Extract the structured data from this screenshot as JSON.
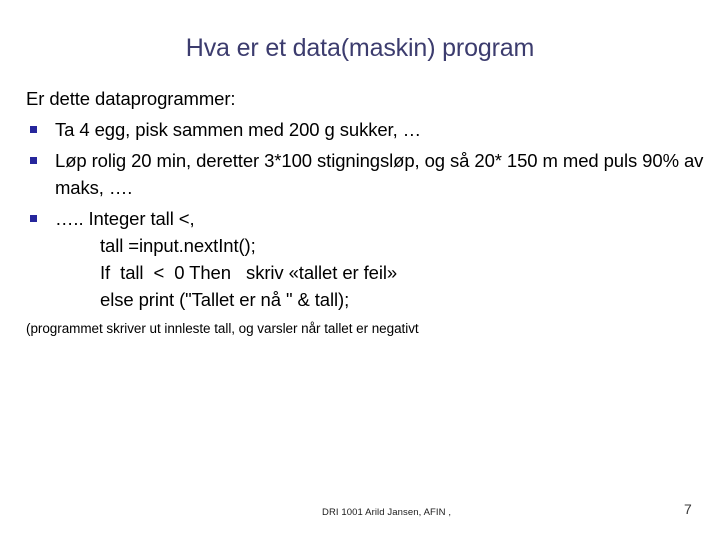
{
  "slide": {
    "title": "Hva er et data(maskin) program",
    "lead": "Er dette dataprogrammer:",
    "bullets": [
      {
        "text": "Ta 4 egg, pisk sammen med 200 g sukker, …"
      },
      {
        "text": "Løp rolig 20 min, deretter 3*100 stigningsløp, og så 20* 150 m med puls 90% av maks, …."
      },
      {
        "text": "….. Integer tall <,"
      }
    ],
    "code_lines": [
      "tall =input.nextInt();",
      "If  tall  <  0 Then   skriv «tallet er feil»",
      "else print (\"Tallet er nå \" & tall);"
    ],
    "note": "(programmet skriver ut innleste tall, og varsler når tallet er negativt",
    "footer": {
      "credit": "DRI 1001 Arild Jansen, AFIN ,",
      "page_number": "7"
    },
    "colors": {
      "title": "#3c3c6e",
      "bullet_marker": "#26269c",
      "body_text": "#000000",
      "background": "#ffffff"
    }
  }
}
